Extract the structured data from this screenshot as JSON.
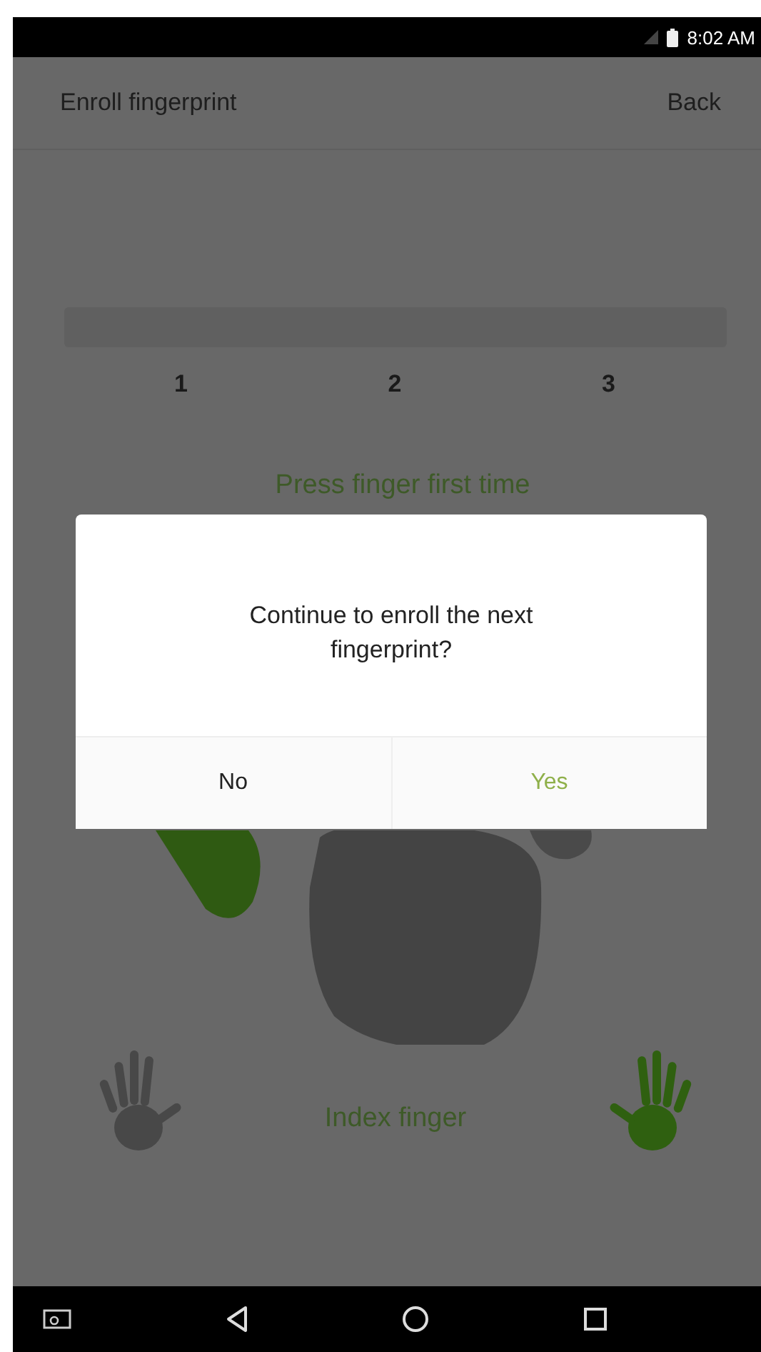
{
  "status_bar": {
    "time": "8:02 AM"
  },
  "app_bar": {
    "title": "Enroll fingerprint",
    "back": "Back"
  },
  "steps": [
    {
      "label": "1"
    },
    {
      "label": "2"
    },
    {
      "label": "3"
    }
  ],
  "prompt": "Press finger first time",
  "progress": {
    "level": 0
  },
  "hands": [
    {
      "selected": false
    },
    {
      "selected": true
    }
  ],
  "finger_label": "Index finger",
  "dialog": {
    "message": "Continue to enroll the next fingerprint?",
    "buttons": [
      {
        "label": "No",
        "kind": "negative"
      },
      {
        "label": "Yes",
        "kind": "positive"
      }
    ]
  }
}
